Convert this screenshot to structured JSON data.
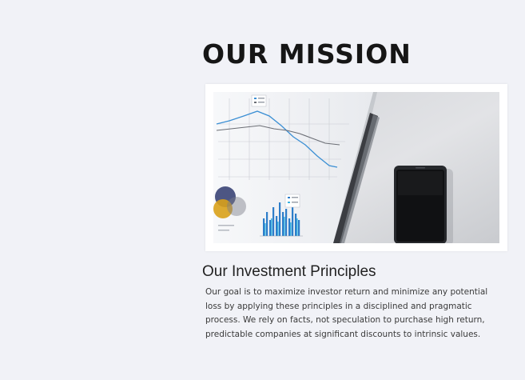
{
  "mission": {
    "title": "OUR MISSION"
  },
  "image": {
    "icon": "document-charts-and-phone-photo"
  },
  "principles": {
    "heading": "Our Investment Principles",
    "body": "Our goal is to maximize investor return and minimize any potential loss by applying these principles in a disciplined and pragmatic process. We rely on facts, not speculation to purchase high return, predictable companies at significant discounts to intrinsic values."
  },
  "colors": {
    "background": "#f1f2f7",
    "title": "#161616",
    "text": "#3a3a3a"
  }
}
